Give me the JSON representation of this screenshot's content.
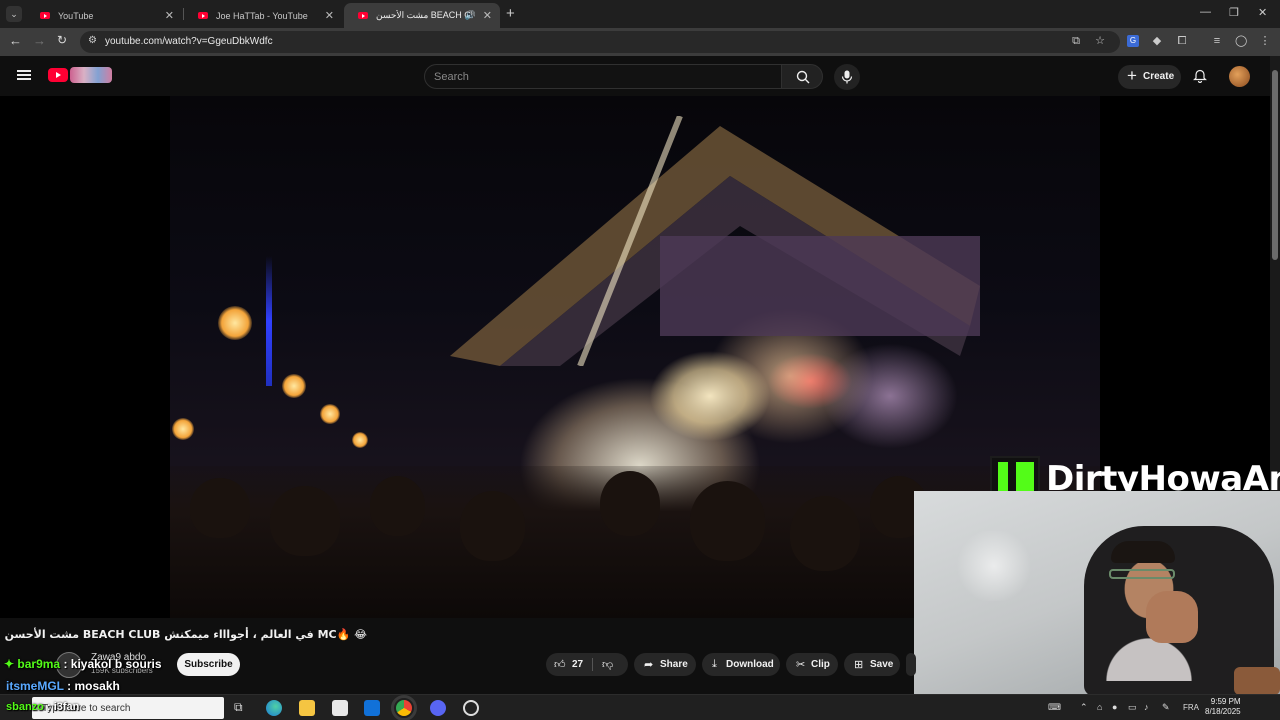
{
  "browser": {
    "tabs": [
      {
        "title": "YouTube",
        "active": false
      },
      {
        "title": "Joe HaTTab - YouTube",
        "active": false
      },
      {
        "title": "مشت الأحسن BEACH CLUB",
        "active": true
      }
    ],
    "url": "youtube.com/watch?v=GgeuDbkWdfc"
  },
  "youtube": {
    "search_placeholder": "Search",
    "create_label": "Create"
  },
  "video": {
    "title": "😂 🔥MC في العالم ، أجواااء ميمكنش BEACH CLUB مشت الأحسن",
    "channel_name": "Zawa9 abdo",
    "subscribers": "159K subscribers",
    "subscribe_label": "Subscribe",
    "likes": "27",
    "share_label": "Share",
    "download_label": "Download",
    "clip_label": "Clip",
    "save_label": "Save"
  },
  "stream_overlay": {
    "kick_name": "DirtyHowaAn",
    "chat": [
      {
        "user": "bar9ma",
        "message": "kiyakol b souris",
        "user_color": "#53fc18"
      },
      {
        "user": "itsmeMGL",
        "message": "mosakh",
        "user_color": "#5aa9ff"
      },
      {
        "user": "sbanzo",
        "message": "i3fan",
        "user_color": "#53fc18"
      }
    ]
  },
  "taskbar": {
    "search_placeholder": "Type here to search",
    "language": "FRA",
    "time": "9:59 PM",
    "date": "8/18/2025"
  }
}
